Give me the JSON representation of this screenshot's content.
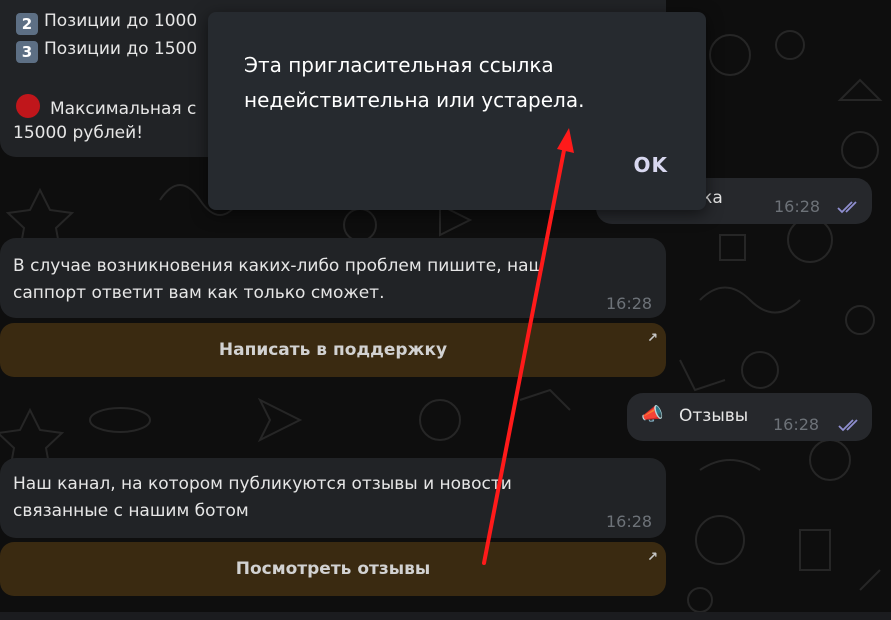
{
  "dialog": {
    "message_line1": "Эта пригласительная ссылка",
    "message_line2": "недействительна или устарела.",
    "ok_label": "OK"
  },
  "top_message": {
    "line_partial_top": "",
    "item2_number": "2",
    "item2_text": "Позиции до 1000",
    "item3_number": "3",
    "item3_text": "Позиции до 1500",
    "max_text": "Максимальная с",
    "max_text_line2": "15000 рублей!"
  },
  "outgoing_support": {
    "text": "ржка",
    "time": "16:28"
  },
  "support_message": {
    "line1": "В случае возникновения каких-либо проблем пишите, наш",
    "line2": "саппорт ответит вам как только сможет.",
    "time": "16:28",
    "button_label": "Написать в поддержку"
  },
  "outgoing_reviews": {
    "text": "Отзывы",
    "time": "16:28",
    "icon": "megaphone-icon"
  },
  "channel_message": {
    "line1": "Наш канал, на котором публикуются отзывы и новости",
    "line2": "связанные с нашим ботом",
    "time": "16:28",
    "button_label": "Посмотреть отзывы"
  },
  "colors": {
    "background": "#0e0e0e",
    "bubble": "#212326",
    "inline_button": "#3a2a11",
    "dialog": "#262a2f",
    "read_checks": "#8f8fd0",
    "annotation_arrow": "#ff1a1a"
  }
}
